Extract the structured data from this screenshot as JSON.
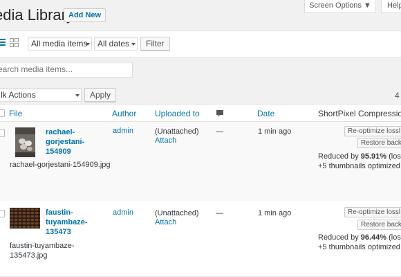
{
  "header": {
    "title": "edia Library",
    "add_new": "Add New",
    "screen_options": "Screen Options ▼",
    "help": "Help"
  },
  "toolbar": {
    "media_filter": "All media items",
    "date_filter": "All dates",
    "filter_button": "Filter",
    "search_placeholder": "earch media items..."
  },
  "bulk": {
    "action": "lk Actions",
    "apply": "Apply",
    "count": "4"
  },
  "table": {
    "columns": {
      "file": "File",
      "author": "Author",
      "uploaded_to": "Uploaded to",
      "date": "Date",
      "shortpixel": "ShortPixel Compression"
    },
    "rows": [
      {
        "title_lines": [
          "rachael-",
          "gorjestani-",
          "154909"
        ],
        "filename_lines": [
          "rachael-gorjestani-154909.jpg"
        ],
        "author": "admin",
        "uploaded": "(Unattached)",
        "attach": "Attach",
        "comments": "—",
        "date": "1 min ago",
        "reoptimize": "Re-optimize lossl",
        "restore": "Restore back",
        "reduced_prefix": "Reduced by ",
        "reduced_pct": "95.91%",
        "reduced_suffix": " (lossy)",
        "thumbs": "+5 thumbnails optimized"
      },
      {
        "title_lines": [
          "faustin-",
          "tuyambaze-",
          "135473"
        ],
        "filename_lines": [
          "faustin-tuyambaze-",
          "135473.jpg"
        ],
        "author": "admin",
        "uploaded": "(Unattached)",
        "attach": "Attach",
        "comments": "—",
        "date": "1 min ago",
        "reoptimize": "Re-optimize lossl",
        "restore": "Restore back",
        "reduced_prefix": "Reduced by ",
        "reduced_pct": "96.44%",
        "reduced_suffix": " (lossy)",
        "thumbs": "+5 thumbnails optimized"
      }
    ]
  },
  "colors": {
    "link": "#0073aa",
    "background": "#f1f1f1"
  }
}
